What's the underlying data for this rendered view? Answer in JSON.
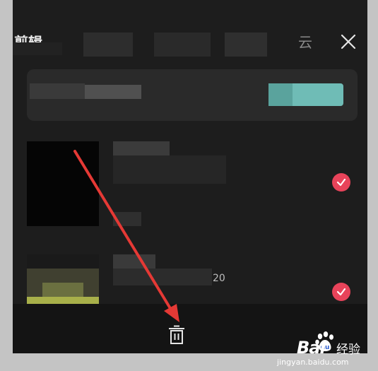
{
  "tabs": {
    "active_label": "剪辑",
    "cloud_label": "云"
  },
  "row2": {
    "count_text": "20"
  },
  "watermark": {
    "brand": "Bai",
    "brand_cn": "经验",
    "url": "jingyan.baidu.com"
  },
  "colors": {
    "panel_bg": "#1d1d1d",
    "check_red": "#e8435a",
    "teal_button": "#6fbcb6",
    "arrow_red": "#e53935"
  },
  "icons": {
    "close": "close-icon",
    "check": "check-icon",
    "trash": "trash-icon",
    "paw": "baidu-paw-icon"
  }
}
